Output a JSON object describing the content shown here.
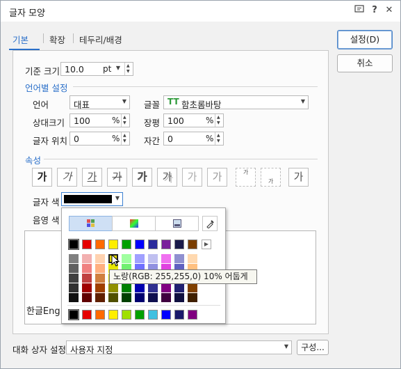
{
  "window": {
    "title": "글자 모양"
  },
  "tabs": [
    "기본",
    "확장",
    "테두리/배경"
  ],
  "buttons": {
    "ok": "설정(D)",
    "cancel": "취소",
    "compose": "구성..."
  },
  "font_size": {
    "label": "기준 크기",
    "value": "10.0",
    "unit": "pt"
  },
  "language_section": "언어별 설정",
  "language": {
    "label": "언어",
    "value": "대표"
  },
  "font": {
    "label": "글꼴",
    "value": "함초롬바탕",
    "icon": "TT"
  },
  "relative_size": {
    "label": "상대크기",
    "value": "100",
    "unit": "%"
  },
  "width_ratio": {
    "label": "장평",
    "value": "100",
    "unit": "%"
  },
  "char_position": {
    "label": "글자 위치",
    "value": "0",
    "unit": "%"
  },
  "spacing": {
    "label": "자간",
    "value": "0",
    "unit": "%"
  },
  "attributes_section": "속성",
  "attributes": [
    "가",
    "가",
    "가",
    "가",
    "가",
    "가",
    "가",
    "가",
    "가",
    "가",
    "가"
  ],
  "text_color": {
    "label": "글자 색",
    "value": "#000000"
  },
  "shade_color": {
    "label": "음영 색"
  },
  "preview_text": "한글Eng",
  "palette": {
    "top_row": [
      "#000000",
      "#e60000",
      "#ff6a00",
      "#ffee00",
      "#00a000",
      "#0000ff",
      "#2b2b9c",
      "#7a1f9c",
      "#1a1a4a",
      "#7a3d00"
    ],
    "shades": [
      [
        "#808080",
        "#f2b0b0",
        "#ffd2b0",
        "#ffff00",
        "#a0ffa0",
        "#a0a0ff",
        "#c0c0f0",
        "#f070f0",
        "#9090d0",
        "#ffd9b0"
      ],
      [
        "#606060",
        "#f08080",
        "#ffb080",
        "#e6e600",
        "#70f070",
        "#7070ff",
        "#9090e0",
        "#e040e0",
        "#6060c0",
        "#ffc080"
      ],
      [
        "#404040",
        "#c04040",
        "#d08040",
        "#c0c000",
        "#40c040",
        "#4040e0",
        "#6060c0",
        "#c000c0",
        "#4040a0",
        "#c08040"
      ],
      [
        "#303030",
        "#a00000",
        "#a04000",
        "#909000",
        "#008000",
        "#0000b0",
        "#303090",
        "#800080",
        "#202070",
        "#804000"
      ],
      [
        "#101010",
        "#600000",
        "#602000",
        "#505000",
        "#004000",
        "#000070",
        "#101050",
        "#400040",
        "#101040",
        "#402000"
      ]
    ],
    "recent": [
      "#000000",
      "#e60000",
      "#ff6a00",
      "#ffee00",
      "#a0e000",
      "#00a000",
      "#40c0e0",
      "#0000ff",
      "#1a1a6a",
      "#800080"
    ]
  },
  "tooltip": "노랑(RGB: 255,255,0) 10% 어둡게",
  "dialog_settings": {
    "label": "대화 상자 설정",
    "value": "사용자 지정"
  }
}
